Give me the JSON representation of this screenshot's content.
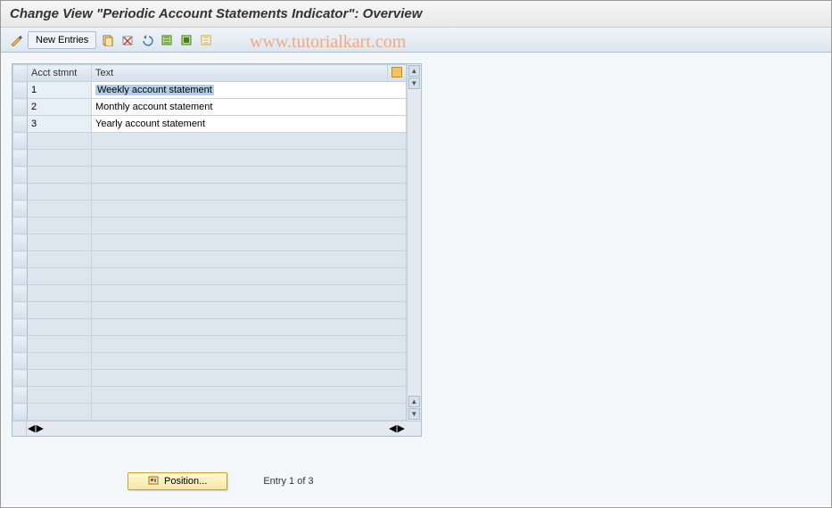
{
  "title": "Change View \"Periodic Account Statements Indicator\": Overview",
  "toolbar": {
    "new_entries": "New Entries"
  },
  "watermark": "www.tutorialkart.com",
  "table": {
    "headers": {
      "acct": "Acct stmnt",
      "text": "Text"
    },
    "rows": [
      {
        "acct": "1",
        "text": "Weekly account statement",
        "selected": true
      },
      {
        "acct": "2",
        "text": "Monthly account statement",
        "selected": false
      },
      {
        "acct": "3",
        "text": "Yearly account statement",
        "selected": false
      }
    ],
    "empty_rows": 17
  },
  "footer": {
    "position_label": "Position...",
    "entry_text": "Entry 1 of 3"
  }
}
